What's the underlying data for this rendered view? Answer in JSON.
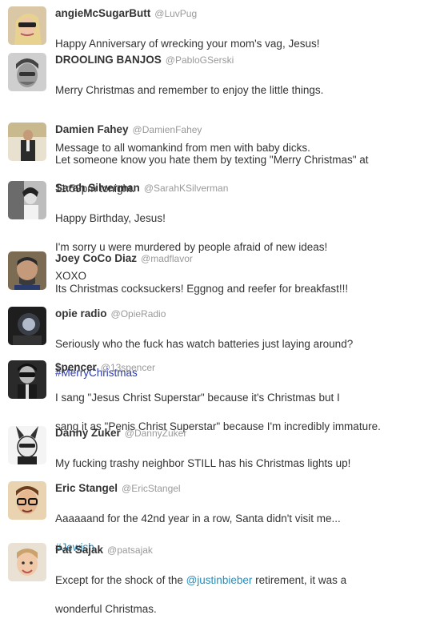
{
  "tweets": [
    {
      "name": "angieMcSugarButt",
      "handle": "@LuvPug",
      "lines": [
        "Happy Anniversary of wrecking your mom's vag, Jesus!"
      ]
    },
    {
      "name": "DROOLING BANJOS",
      "handle": "@PabloGSerski",
      "lines": [
        "Merry Christmas and remember to enjoy the little things.",
        "Message to all womankind from men with baby dicks."
      ]
    },
    {
      "name": "Damien Fahey",
      "handle": "@DamienFahey",
      "lines": [
        "Let someone know you hate them by texting \"Merry Christmas\" at",
        "11:59pm tonight."
      ]
    },
    {
      "name": "Sarah Silverman",
      "handle": "@SarahKSilverman",
      "lines": [
        "Happy Birthday, Jesus!",
        "I'm sorry u were murdered by people afraid of new ideas!",
        "XOXO"
      ]
    },
    {
      "name": "Joey CoCo Diaz",
      "handle": "@madflavor",
      "lines": [
        "Its Christmas cocksuckers! Eggnog and reefer for breakfast!!!"
      ]
    },
    {
      "name": "opie radio",
      "handle": "@OpieRadio",
      "lines": [
        "Seriously who the fuck has watch batteries just laying around?"
      ],
      "hashtag": "#MerryChristmas"
    },
    {
      "name": "$pencer",
      "handle": "@13spencer",
      "lines": [
        "I sang \"Jesus Christ Superstar\" because it's Christmas but I",
        "sang it as \"Penis Christ Superstar\" because I'm incredibly immature."
      ]
    },
    {
      "name": "Danny Zuker",
      "handle": "@DannyZuker",
      "lines": [
        "My fucking trashy neighbor STILL has his Christmas lights up!"
      ]
    },
    {
      "name": "Eric Stangel",
      "handle": "@EricStangel",
      "lines": [
        "Aaaaaand for the 42nd year in a row, Santa didn't visit me..."
      ],
      "hashtag": "#Jewish"
    },
    {
      "name": "Pat Sajak",
      "handle": "@patsajak",
      "text_before": "Except for the shock of the ",
      "mention": "@justinbieber",
      "text_after": " retirement, it was a",
      "line2": "wonderful Christmas."
    }
  ]
}
